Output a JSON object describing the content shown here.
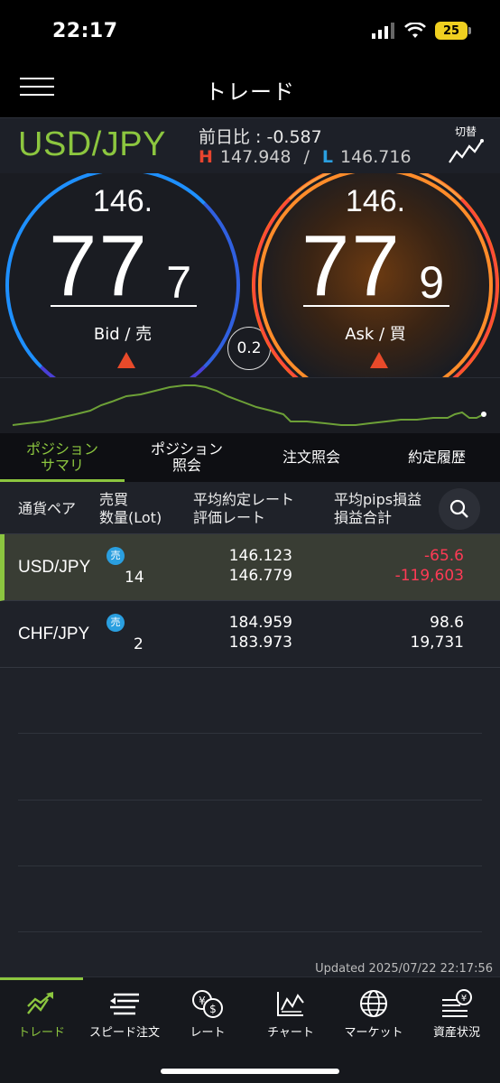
{
  "status": {
    "time": "22:17",
    "battery": "25"
  },
  "nav": {
    "title": "トレード"
  },
  "pair": {
    "name": "USD/JPY",
    "change_label": "前日比 : -0.587",
    "high_mark": "H",
    "high": "147.948",
    "separator": "/",
    "low_mark": "L",
    "low": "146.716",
    "switch_label": "切替"
  },
  "bid": {
    "prefix": "146.",
    "big": "77",
    "pip": "7",
    "label": "Bid / 売"
  },
  "ask": {
    "prefix": "146.",
    "big": "77",
    "pip": "9",
    "label": "Ask / 買"
  },
  "spread": "0.2",
  "tabs": [
    {
      "label1": "ポジション",
      "label2": "サマリ"
    },
    {
      "label1": "ポジション",
      "label2": "照会"
    },
    {
      "label1": "注文照会",
      "label2": ""
    },
    {
      "label1": "約定履歴",
      "label2": ""
    }
  ],
  "table": {
    "col_pair": "通貨ペア",
    "col_side1": "売買",
    "col_side2": "数量(Lot)",
    "col_rate1": "平均約定レート",
    "col_rate2": "評価レート",
    "col_pips1": "平均pips損益",
    "col_pips2": "損益合計",
    "rows": [
      {
        "pair": "USD/JPY",
        "side": "売",
        "lot": "14",
        "avg_rate": "146.123",
        "eval_rate": "146.779",
        "pips": "-65.6",
        "pl": "-119,603"
      },
      {
        "pair": "CHF/JPY",
        "side": "売",
        "lot": "2",
        "avg_rate": "184.959",
        "eval_rate": "183.973",
        "pips": "98.6",
        "pl": "19,731"
      }
    ]
  },
  "updated": "Updated  2025/07/22 22:17:56",
  "tabbar": [
    {
      "label": "トレード",
      "icon": "trade-icon"
    },
    {
      "label": "スピード注文",
      "icon": "speed-order-icon"
    },
    {
      "label": "レート",
      "icon": "rate-icon"
    },
    {
      "label": "チャート",
      "icon": "chart-icon"
    },
    {
      "label": "マーケット",
      "icon": "market-globe-icon"
    },
    {
      "label": "資産状況",
      "icon": "assets-icon"
    }
  ],
  "colors": {
    "accent": "#8cc63f",
    "negative": "#ff3a55",
    "bid": "#1e90ff",
    "ask": "#ff8c2a"
  }
}
